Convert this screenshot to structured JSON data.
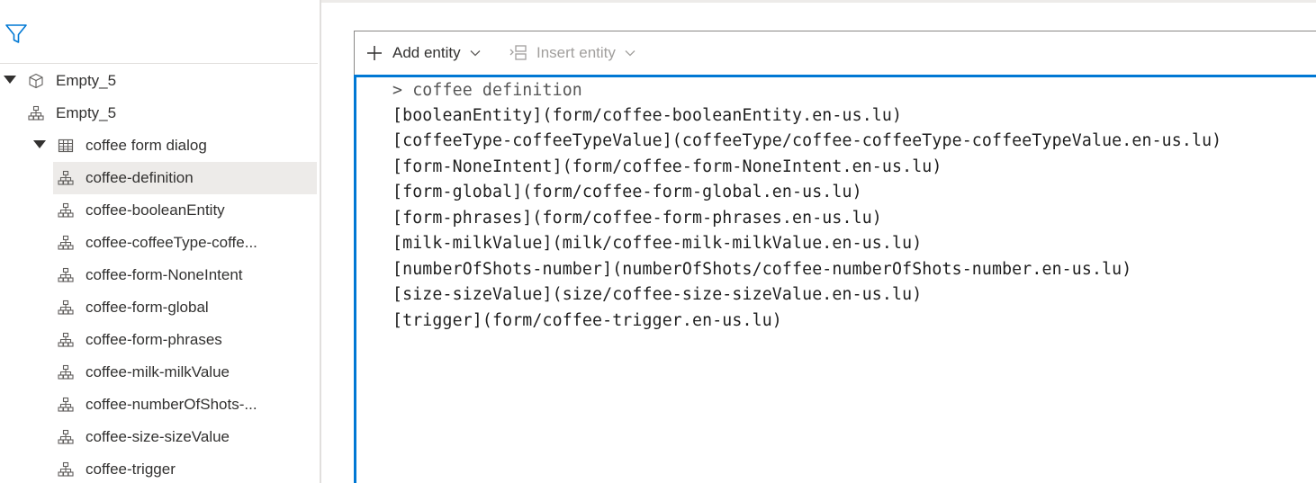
{
  "tree": {
    "items": [
      {
        "label": "Empty_5",
        "icon": "cube-icon",
        "caret": true,
        "selected": false
      },
      {
        "label": "Empty_5",
        "icon": "hierarchy-icon",
        "caret": false,
        "selected": false
      },
      {
        "label": "coffee form dialog",
        "icon": "table-icon",
        "caret": true,
        "selected": false
      },
      {
        "label": "coffee-definition",
        "icon": "hierarchy-icon",
        "caret": false,
        "selected": true
      },
      {
        "label": "coffee-booleanEntity",
        "icon": "hierarchy-icon",
        "caret": false,
        "selected": false
      },
      {
        "label": "coffee-coffeeType-coffe...",
        "icon": "hierarchy-icon",
        "caret": false,
        "selected": false
      },
      {
        "label": "coffee-form-NoneIntent",
        "icon": "hierarchy-icon",
        "caret": false,
        "selected": false
      },
      {
        "label": "coffee-form-global",
        "icon": "hierarchy-icon",
        "caret": false,
        "selected": false
      },
      {
        "label": "coffee-form-phrases",
        "icon": "hierarchy-icon",
        "caret": false,
        "selected": false
      },
      {
        "label": "coffee-milk-milkValue",
        "icon": "hierarchy-icon",
        "caret": false,
        "selected": false
      },
      {
        "label": "coffee-numberOfShots-...",
        "icon": "hierarchy-icon",
        "caret": false,
        "selected": false
      },
      {
        "label": "coffee-size-sizeValue",
        "icon": "hierarchy-icon",
        "caret": false,
        "selected": false
      },
      {
        "label": "coffee-trigger",
        "icon": "hierarchy-icon",
        "caret": false,
        "selected": false
      }
    ]
  },
  "toolbar": {
    "add_entity": "Add entity",
    "insert_entity": "Insert entity"
  },
  "editor": {
    "lines": [
      "> coffee definition",
      "[booleanEntity](form/coffee-booleanEntity.en-us.lu)",
      "[coffeeType-coffeeTypeValue](coffeeType/coffee-coffeeType-coffeeTypeValue.en-us.lu)",
      "[form-NoneIntent](form/coffee-form-NoneIntent.en-us.lu)",
      "[form-global](form/coffee-form-global.en-us.lu)",
      "[form-phrases](form/coffee-form-phrases.en-us.lu)",
      "[milk-milkValue](milk/coffee-milk-milkValue.en-us.lu)",
      "[numberOfShots-number](numberOfShots/coffee-numberOfShots-number.en-us.lu)",
      "[size-sizeValue](size/coffee-size-sizeValue.en-us.lu)",
      "[trigger](form/coffee-trigger.en-us.lu)"
    ]
  },
  "colors": {
    "accent": "#0078d4",
    "selected_bg": "#edebe9",
    "text": "#323130",
    "disabled_text": "#a19f9d"
  }
}
